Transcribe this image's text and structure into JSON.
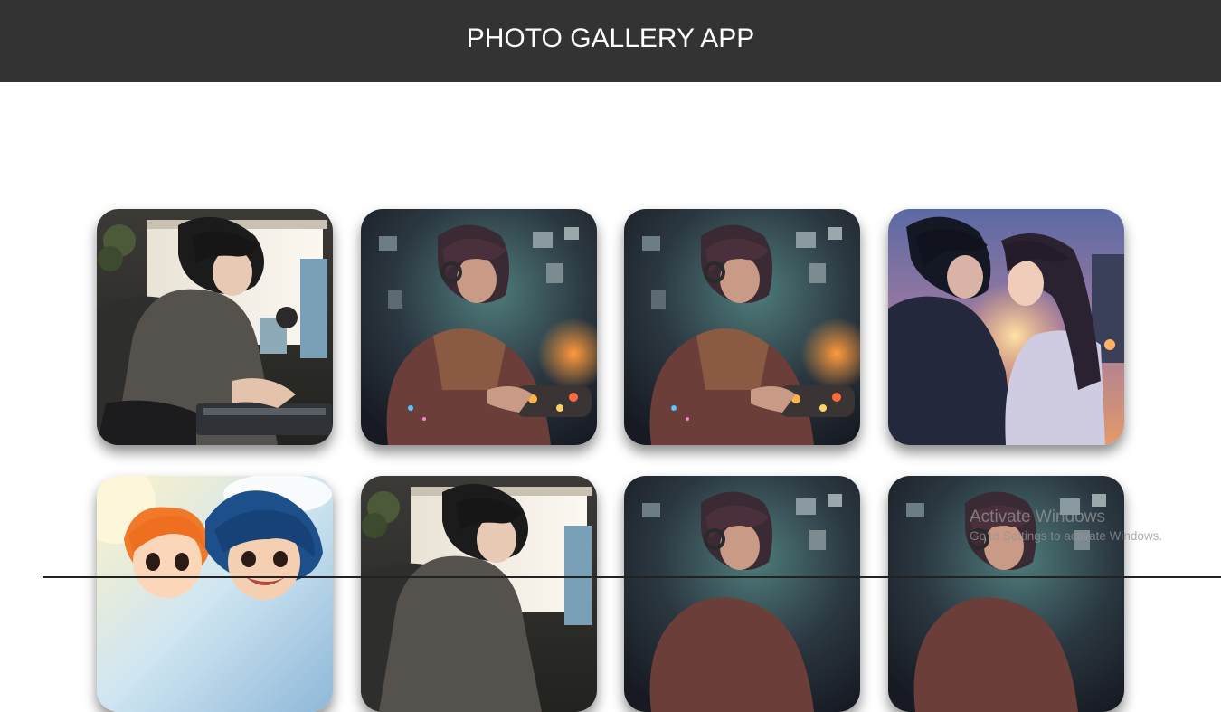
{
  "header": {
    "title": "PHOTO GALLERY APP",
    "background": "#333333"
  },
  "gallery": {
    "photos": [
      {
        "subject": "boy-at-computer",
        "palette": "warm-gray"
      },
      {
        "subject": "gamer-with-controller",
        "palette": "neon-teal"
      },
      {
        "subject": "gamer-with-controller",
        "palette": "neon-teal"
      },
      {
        "subject": "couple-at-sunset",
        "palette": "dusk-blue"
      },
      {
        "subject": "two-smiling-kids",
        "palette": "bright-sky"
      },
      {
        "subject": "boy-at-computer",
        "palette": "warm-gray"
      },
      {
        "subject": "gamer-with-controller",
        "palette": "neon-teal"
      },
      {
        "subject": "gamer-with-controller",
        "palette": "neon-teal"
      }
    ]
  },
  "watermark": {
    "title": "Activate Windows",
    "subtitle": "Go to Settings to activate Windows."
  }
}
